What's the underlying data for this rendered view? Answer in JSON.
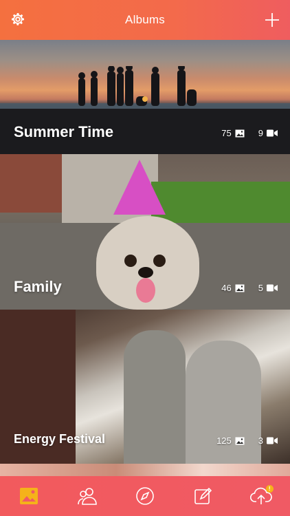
{
  "header": {
    "title": "Albums",
    "left_icon": "gear-icon",
    "right_icon": "plus-icon"
  },
  "albums": [
    {
      "name": "Summer Time",
      "photos": "75",
      "videos": "9"
    },
    {
      "name": "Family",
      "photos": "46",
      "videos": "5"
    },
    {
      "name": "Energy Festival",
      "photos": "125",
      "videos": "3"
    }
  ],
  "tabbar": {
    "items": [
      {
        "icon": "albums-icon",
        "selected": true
      },
      {
        "icon": "people-icon"
      },
      {
        "icon": "compass-icon"
      },
      {
        "icon": "edit-icon"
      },
      {
        "icon": "cloud-upload-icon",
        "badge": "!"
      }
    ],
    "selected_color": "#f5b21a"
  },
  "colors": {
    "header_start": "#f4703f",
    "header_end": "#ef5d5f",
    "tabbar": "#f05a64",
    "accent": "#f5b21a"
  }
}
